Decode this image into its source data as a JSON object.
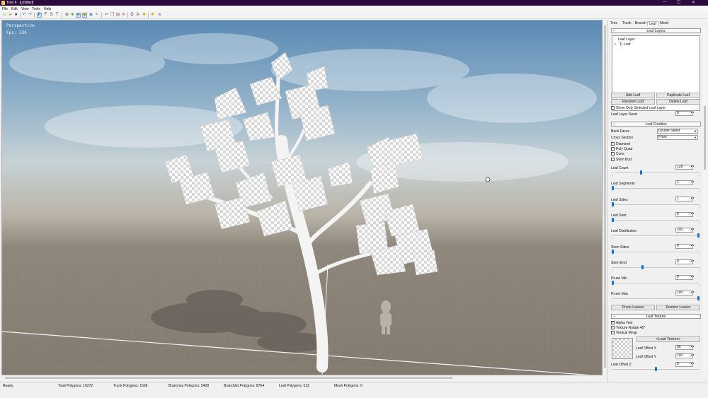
{
  "window": {
    "title": "Tree It - [Untitled]",
    "minimize": "—",
    "maximize": "☐",
    "close": "✕"
  },
  "menu": [
    "File",
    "Edit",
    "View",
    "Tools",
    "Help"
  ],
  "toolbar": {
    "icons": [
      "new-file-icon",
      "open-file-icon",
      "save-icon",
      "undo-icon",
      "redo-icon",
      "perspective-view-button",
      "front-view-button",
      "side-view-button",
      "top-view-button",
      "globe-icon",
      "leaf-icon",
      "sphere-icon",
      "light-icon",
      "texture-icon",
      "zoom-icon",
      "cut-icon",
      "copy-icon",
      "paste-icon",
      "delete-icon",
      "diffuse-button",
      "alpha-button",
      "sun-icon",
      "palette-icon",
      "settings-icon",
      "wind-icon"
    ],
    "view_letters": [
      "P",
      "F",
      "S",
      "T"
    ],
    "render_letters": [
      "D",
      "A"
    ]
  },
  "viewport": {
    "mode": "Perspective",
    "fps": "Fps: 234"
  },
  "status": {
    "ready": "Ready",
    "total": "Total Polygons: 16272",
    "trunk": "Trunk Polygons: 1568",
    "branches": "Branches Polygons: 5428",
    "branchlet": "Branchlet Polygons: 8764",
    "leaf": "Leaf Polygons: 512",
    "mesh": "Mesh Polygons: 0"
  },
  "panel": {
    "tabs": [
      "Tree",
      "Trunk",
      "Branch",
      "Leaf",
      "Mesh"
    ],
    "active_tab": "Leaf",
    "leaf_layers": {
      "header": "Leaf Layers",
      "root": "Leaf Layer",
      "child": "1) Leaf",
      "add": "Add Leaf",
      "duplicate": "Duplicate Leaf",
      "rename": "Rename Leaf",
      "delete": "Delete Leaf",
      "show_only": "Show Only Selected Leaf Layer",
      "seed_label": "Leaf Layer Seed",
      "seed_value": "0"
    },
    "leaf_creation": {
      "header": "Leaf Creation",
      "back_faces_label": "Back Faces",
      "back_faces_value": "Double Sided",
      "cross_section_label": "Cross Section",
      "cross_section_value": "Front",
      "shapes": [
        "Diamond",
        "Poly Quad",
        "Cone",
        "Stem Bud"
      ],
      "params": [
        {
          "label": "Leaf Count",
          "value": "128",
          "level": 0.33
        },
        {
          "label": "Leaf Segments",
          "value": "1",
          "level": 0.0
        },
        {
          "label": "Leaf Sides",
          "value": "1",
          "level": 0.0
        },
        {
          "label": "Leaf Start",
          "value": "0",
          "level": 0.0
        },
        {
          "label": "Leaf Distribution",
          "value": "100",
          "level": 1.0
        },
        {
          "label": "Stem Sides",
          "value": "0",
          "level": 0.0
        },
        {
          "label": "Stem End",
          "value": "0",
          "level": 0.35
        },
        {
          "label": "Prune Min",
          "value": "0",
          "level": 0.0
        },
        {
          "label": "Prune Max",
          "value": "100",
          "level": 1.0
        }
      ],
      "prune_leaves": "Prune Leaves",
      "restore_leaves": "Restore Leaves"
    },
    "leaf_texture": {
      "header": "Leaf Texture",
      "alpha_test": "Alpha Test",
      "texture_rotate": "Texture Rotate 45°",
      "vertical_wrap": "Vertical Wrap",
      "load_texture": "<Load Texture>",
      "offset_x_label": "Leaf Offset X",
      "offset_x_value": "50",
      "offset_y_label": "Leaf Offset Y",
      "offset_y_value": "100",
      "offset_z_label": "Leaf Offset Z",
      "offset_z_value": "0",
      "offset_z_level": 0.5
    }
  }
}
